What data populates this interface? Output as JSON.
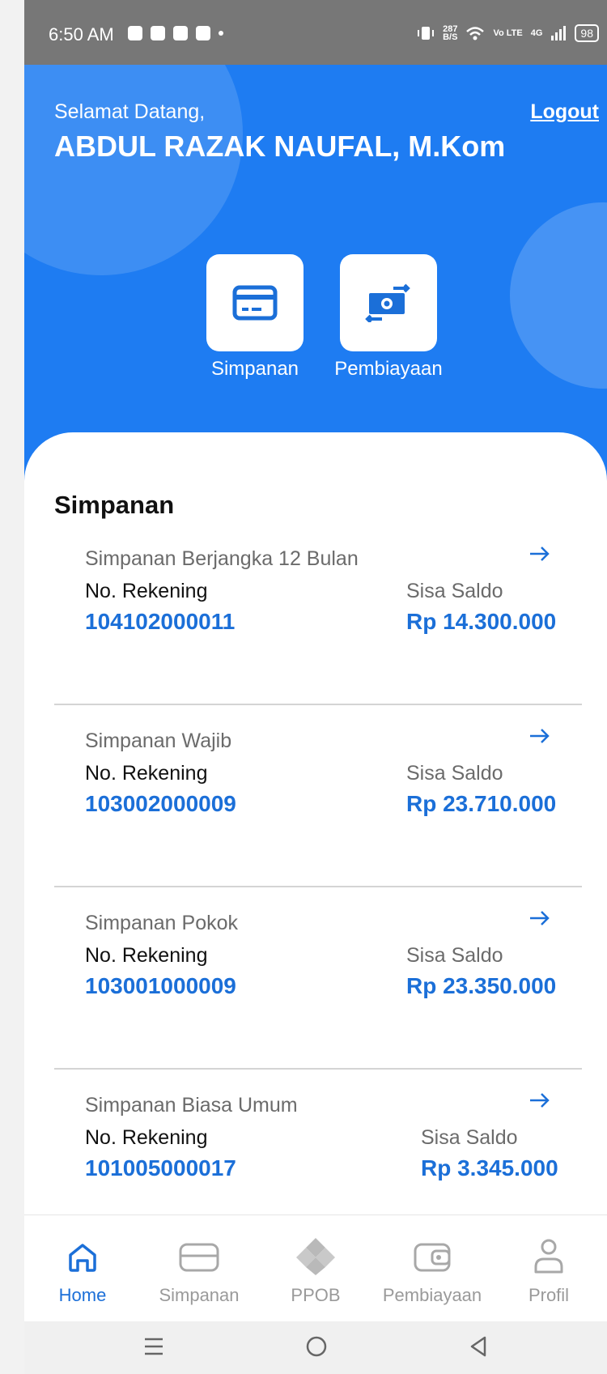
{
  "status_bar": {
    "time": "6:50 AM",
    "network_speed": "287",
    "network_unit": "B/S",
    "volte": "Vo LTE",
    "signal": "4G",
    "battery": "98"
  },
  "header": {
    "greeting": "Selamat Datang,",
    "user_name": "ABDUL RAZAK NAUFAL, M.Kom",
    "logout_label": "Logout",
    "menu": [
      {
        "label": "Simpanan",
        "icon": "credit-card-icon"
      },
      {
        "label": "Pembiayaan",
        "icon": "money-transfer-icon"
      }
    ]
  },
  "main": {
    "section_title": "Simpanan",
    "accounts": [
      {
        "name": "Simpanan Berjangka 12 Bulan",
        "rek_label": "No. Rekening",
        "rek_number": "104102000011",
        "saldo_label": "Sisa Saldo",
        "saldo": "Rp 14.300.000"
      },
      {
        "name": "Simpanan Wajib",
        "rek_label": "No. Rekening",
        "rek_number": "103002000009",
        "saldo_label": "Sisa Saldo",
        "saldo": "Rp 23.710.000"
      },
      {
        "name": "Simpanan Pokok",
        "rek_label": "No. Rekening",
        "rek_number": "103001000009",
        "saldo_label": "Sisa Saldo",
        "saldo": "Rp 23.350.000"
      },
      {
        "name": "Simpanan Biasa Umum",
        "rek_label": "No. Rekening",
        "rek_number": "101005000017",
        "saldo_label": "Sisa Saldo",
        "saldo": "Rp 3.345.000"
      }
    ]
  },
  "bottom_nav": {
    "items": [
      {
        "label": "Home",
        "icon": "home-icon",
        "active": true
      },
      {
        "label": "Simpanan",
        "icon": "card-icon",
        "active": false
      },
      {
        "label": "PPOB",
        "icon": "ppob-icon",
        "active": false
      },
      {
        "label": "Pembiayaan",
        "icon": "wallet-icon",
        "active": false
      },
      {
        "label": "Profil",
        "icon": "profile-icon",
        "active": false
      }
    ]
  },
  "colors": {
    "primary_blue": "#1e7cf2",
    "link_blue": "#1b6fd8",
    "status_bar": "#777777"
  }
}
